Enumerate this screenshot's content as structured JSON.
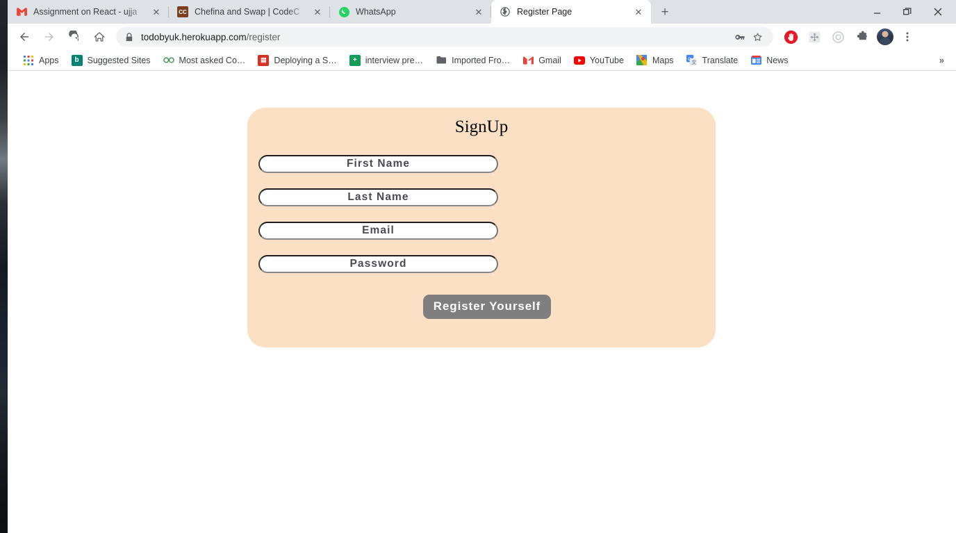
{
  "window": {
    "controls": {
      "minimize": "minimize-icon",
      "restore": "restore-icon",
      "close": "close-icon"
    }
  },
  "tabs": [
    {
      "title": "Assignment on React - ujja",
      "favicon": "gmail-icon",
      "active": false
    },
    {
      "title": "Chefina and Swap | CodeC",
      "favicon": "codechef-icon",
      "active": false
    },
    {
      "title": "WhatsApp",
      "favicon": "whatsapp-icon",
      "active": false
    },
    {
      "title": "Register Page",
      "favicon": "globe-icon",
      "active": true
    }
  ],
  "newtab_label": "+",
  "toolbar": {
    "back": "back-arrow-icon",
    "forward": "forward-arrow-icon",
    "reload": "reload-icon",
    "home": "home-icon",
    "lock": "lock-icon",
    "url_host": "todobyuk.herokuapp.com",
    "url_path": "/register",
    "url_full": "todobyuk.herokuapp.com/register",
    "omnibox_icons": [
      "key-icon",
      "star-icon"
    ],
    "extensions": [
      "adblock-stop-icon",
      "grid-extension-icon",
      "target-extension-icon",
      "puzzle-icon"
    ],
    "profile": "avatar",
    "menu": "three-dot-menu-icon"
  },
  "bookmarks": [
    {
      "label": "Apps",
      "icon": "apps-grid-icon"
    },
    {
      "label": "Suggested Sites",
      "icon": "bing-icon"
    },
    {
      "label": "Most asked Co…",
      "icon": "geeksforgeeks-icon"
    },
    {
      "label": "Deploying a S…",
      "icon": "red-doc-icon"
    },
    {
      "label": "interview pre…",
      "icon": "sheets-icon"
    },
    {
      "label": "Imported Fro…",
      "icon": "folder-icon"
    },
    {
      "label": "Gmail",
      "icon": "gmail-icon"
    },
    {
      "label": "YouTube",
      "icon": "youtube-icon"
    },
    {
      "label": "Maps",
      "icon": "maps-icon"
    },
    {
      "label": "Translate",
      "icon": "translate-icon"
    },
    {
      "label": "News",
      "icon": "news-icon"
    }
  ],
  "bookmarks_overflow": "»",
  "signup": {
    "title": "SignUp",
    "card_color": "#fbe0c3",
    "fields": [
      {
        "name": "first-name",
        "placeholder": "First Name",
        "value": "",
        "type": "text"
      },
      {
        "name": "last-name",
        "placeholder": "Last Name",
        "value": "",
        "type": "text"
      },
      {
        "name": "email",
        "placeholder": "Email",
        "value": "",
        "type": "text"
      },
      {
        "name": "password",
        "placeholder": "Password",
        "value": "",
        "type": "password"
      }
    ],
    "submit_label": "Register Yourself",
    "submit_color": "#7f7f7f"
  }
}
